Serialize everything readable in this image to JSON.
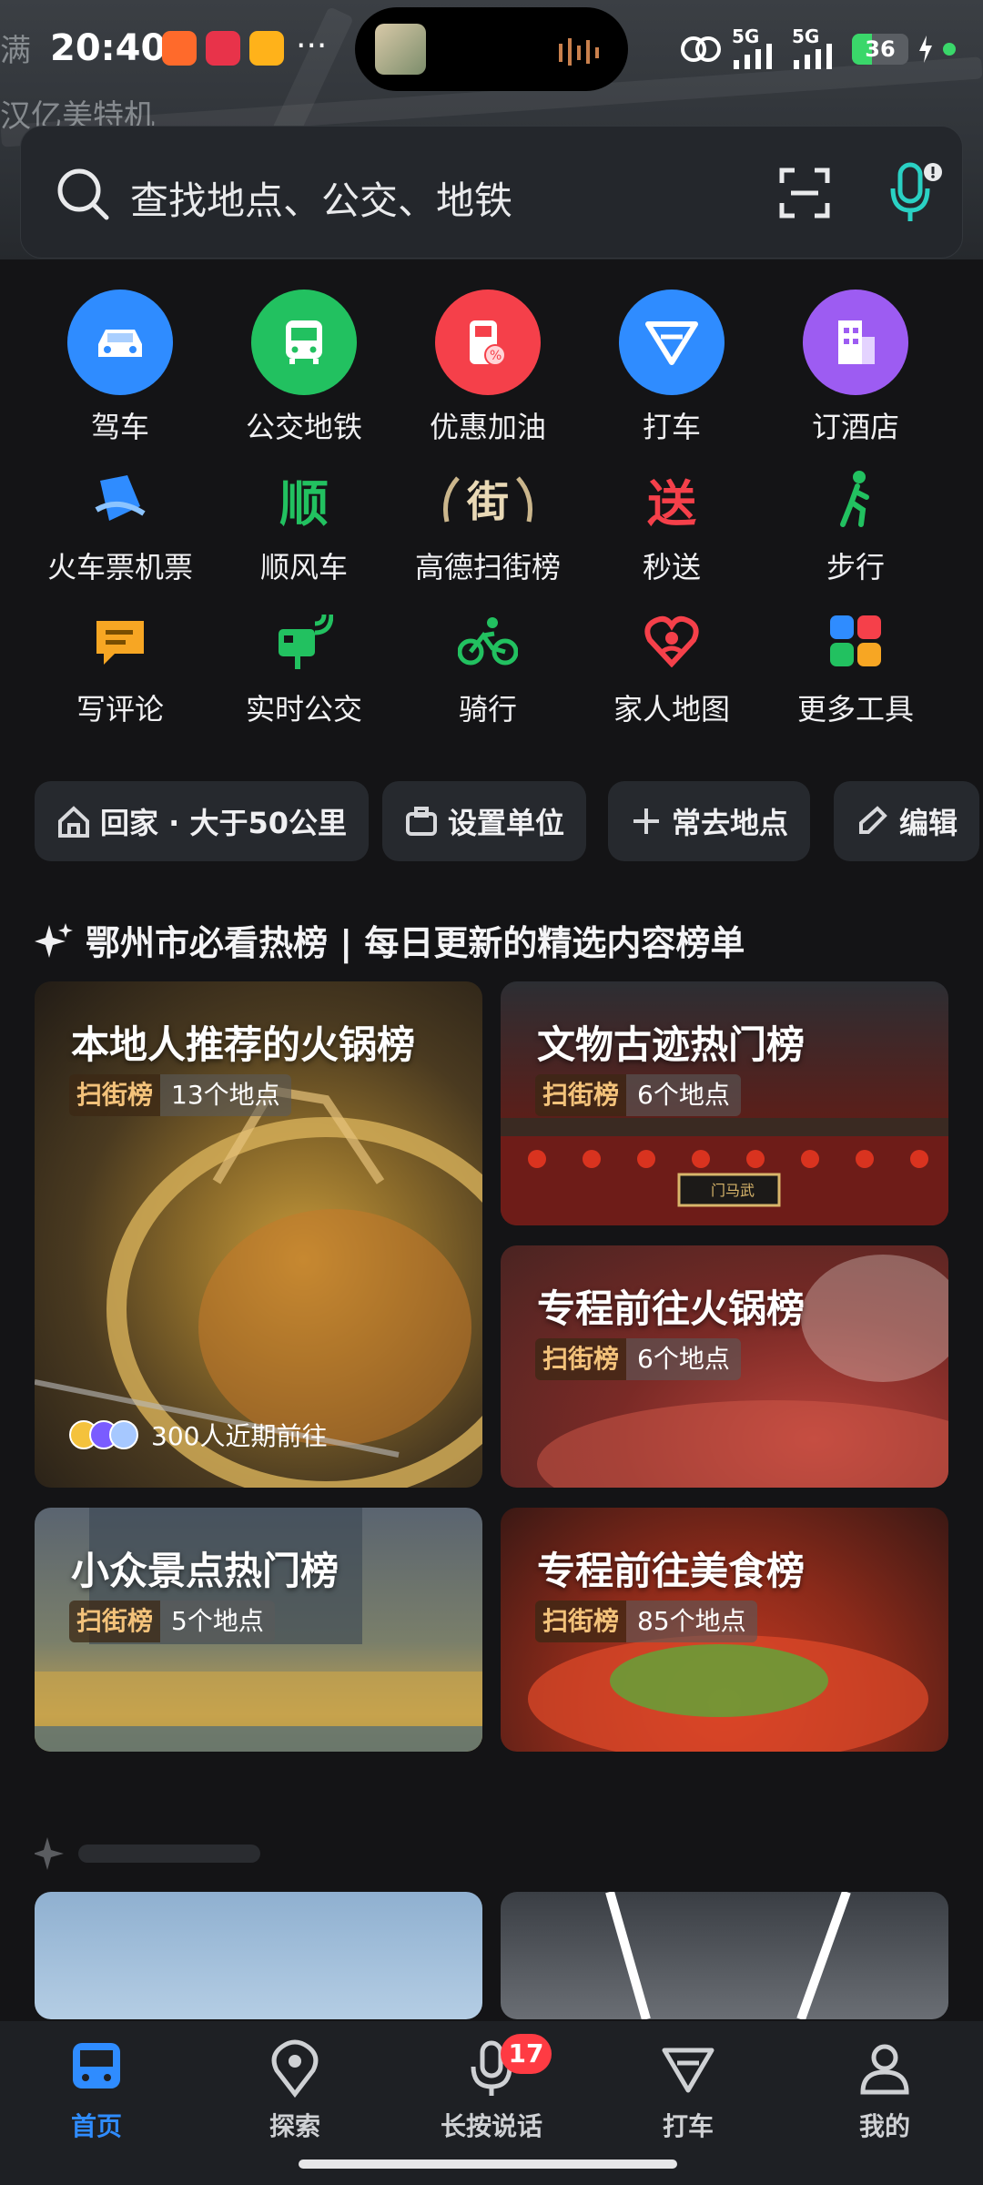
{
  "status_bar": {
    "time": "20:40",
    "dots": "···",
    "signal_1": "5G",
    "signal_2": "5G",
    "battery": "36"
  },
  "map": {
    "labels": [
      "汉亿美特机",
      "满"
    ]
  },
  "search": {
    "placeholder": "查找地点、公交、地铁"
  },
  "quick_grid": [
    {
      "label": "驾车",
      "icon": "car-icon",
      "color": "#2f8cff"
    },
    {
      "label": "公交地铁",
      "icon": "bus-icon",
      "color": "#22c160"
    },
    {
      "label": "优惠加油",
      "icon": "fuel-icon",
      "color": "#f5404a"
    },
    {
      "label": "打车",
      "icon": "taxi-icon",
      "color": "#2f8cff"
    },
    {
      "label": "订酒店",
      "icon": "hotel-icon",
      "color": "#9d5cf2"
    },
    {
      "label": "火车票机票",
      "icon": "train-plane-icon",
      "color": "#2f8cff"
    },
    {
      "label": "顺风车",
      "icon": "carpool-icon",
      "color": "#22c160"
    },
    {
      "label": "高德扫街榜",
      "icon": "street-rank-icon",
      "color": "#d9c29a"
    },
    {
      "label": "秒送",
      "icon": "delivery-icon",
      "color": "#f5404a"
    },
    {
      "label": "步行",
      "icon": "walk-icon",
      "color": "#22c160"
    },
    {
      "label": "写评论",
      "icon": "comment-icon",
      "color": "#f7a623"
    },
    {
      "label": "实时公交",
      "icon": "realtime-bus-icon",
      "color": "#22c160"
    },
    {
      "label": "骑行",
      "icon": "bike-icon",
      "color": "#22c160"
    },
    {
      "label": "家人地图",
      "icon": "family-map-icon",
      "color": "#f5404a"
    },
    {
      "label": "更多工具",
      "icon": "more-tools-icon",
      "color": "#2f8cff"
    }
  ],
  "quick_grid_glyphs": {
    "carpool": "顺",
    "delivery": "送",
    "street_rank": "街"
  },
  "chips": [
    {
      "label": "回家 · 大于50公里",
      "icon": "home-icon"
    },
    {
      "label": "设置单位",
      "icon": "briefcase-icon"
    },
    {
      "label": "常去地点",
      "icon": "plus-icon"
    },
    {
      "label": "编辑",
      "icon": "edit-icon"
    }
  ],
  "hot_section": {
    "title": "鄂州市必看热榜 | 每日更新的精选内容榜单"
  },
  "cards": [
    {
      "title": "本地人推荐的火锅榜",
      "tag": "扫街榜",
      "count": "13个地点",
      "visitors": "300人近期前往"
    },
    {
      "title": "文物古迹热门榜",
      "tag": "扫街榜",
      "count": "6个地点",
      "sign": "门马武"
    },
    {
      "title": "专程前往火锅榜",
      "tag": "扫街榜",
      "count": "6个地点"
    },
    {
      "title": "小众景点热门榜",
      "tag": "扫街榜",
      "count": "5个地点"
    },
    {
      "title": "专程前往美食榜",
      "tag": "扫街榜",
      "count": "85个地点"
    }
  ],
  "bottom_nav": [
    {
      "label": "首页",
      "icon": "home-bus-icon",
      "active": true
    },
    {
      "label": "探索",
      "icon": "location-pin-icon",
      "active": false
    },
    {
      "label": "长按说话",
      "icon": "mic-icon",
      "active": false,
      "badge": "17"
    },
    {
      "label": "打车",
      "icon": "taxi-icon",
      "active": false
    },
    {
      "label": "我的",
      "icon": "user-icon",
      "active": false
    }
  ]
}
